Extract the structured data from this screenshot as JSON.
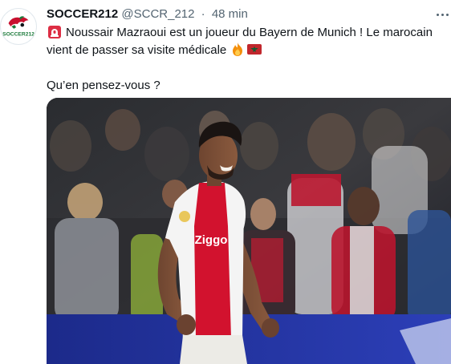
{
  "tweet": {
    "display_name": "SOCCER212",
    "handle": "@SCCR_212",
    "separator": "·",
    "time": "48 min",
    "text_line1": "Noussair Mazraoui est un joueur du Bayern de Munich ! Le marocain",
    "text_line2": "vient de passer sa visite médicale",
    "question": "Qu’en pensez-vous ?",
    "avatar_wordmark": "SOCCER212",
    "shirt_sponsor": "Ziggo"
  },
  "icons": {
    "siren": "police-light-emoji",
    "fire": "fire-emoji",
    "flag": "morocco-flag-emoji",
    "more": "more-horizontal-icon"
  },
  "colors": {
    "text": "#0f1419",
    "secondary": "#536471",
    "ajax_red": "#d2122e",
    "morocco_red": "#c1272d",
    "morocco_green": "#006233"
  }
}
